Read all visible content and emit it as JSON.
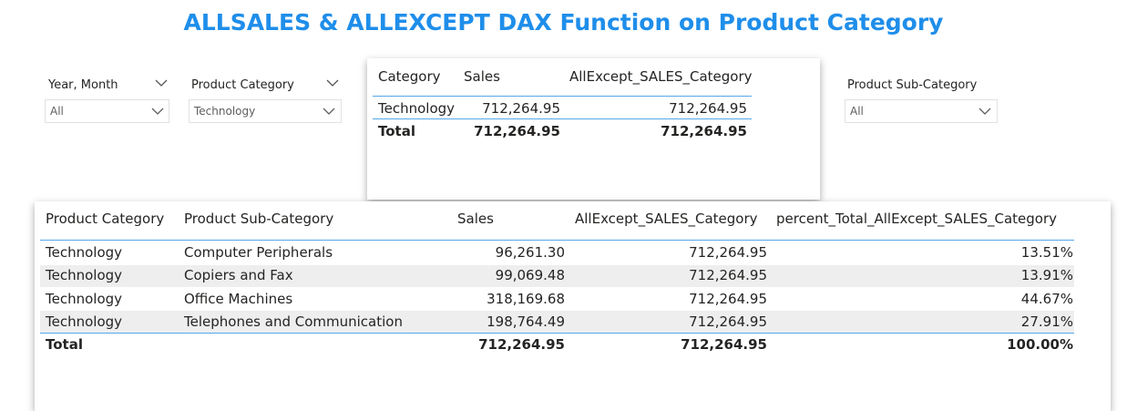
{
  "title": "ALLSALES & ALLEXCEPT DAX Function on Product Category",
  "slicers": {
    "year_month": {
      "label": "Year, Month",
      "value": "All"
    },
    "product_category": {
      "label": "Product Category",
      "value": "Technology"
    },
    "product_subcategory": {
      "label": "Product Sub-Category",
      "value": "All"
    }
  },
  "small_table": {
    "headers": [
      "Category",
      "Sales",
      "AllExcept_SALES_Category"
    ],
    "rows": [
      [
        "Technology",
        "712,264.95",
        "712,264.95"
      ]
    ],
    "total": [
      "Total",
      "712,264.95",
      "712,264.95"
    ]
  },
  "main_table": {
    "headers": [
      "Product Category",
      "Product Sub-Category",
      "Sales",
      "AllExcept_SALES_Category",
      "percent_Total_AllExcept_SALES_Category"
    ],
    "rows": [
      [
        "Technology",
        "Computer Peripherals",
        "96,261.30",
        "712,264.95",
        "13.51%"
      ],
      [
        "Technology",
        "Copiers and Fax",
        "99,069.48",
        "712,264.95",
        "13.91%"
      ],
      [
        "Technology",
        "Office Machines",
        "318,169.68",
        "712,264.95",
        "44.67%"
      ],
      [
        "Technology",
        "Telephones and Communication",
        "198,764.49",
        "712,264.95",
        "27.91%"
      ]
    ],
    "total": [
      "Total",
      "",
      "712,264.95",
      "712,264.95",
      "100.00%"
    ]
  },
  "colors": {
    "title": "#1f8eea",
    "accent_line": "#55a8e8",
    "alt_row": "#eeeeee"
  }
}
